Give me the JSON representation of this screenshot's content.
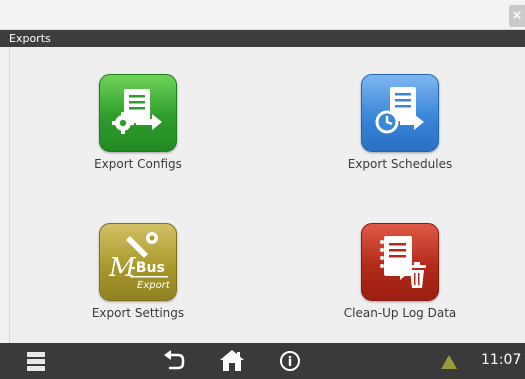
{
  "window": {
    "close_glyph": "×",
    "title": "Exports"
  },
  "tiles": [
    {
      "label": "Export Configs",
      "icon": "export-configs-icon",
      "color": "#2f9c2b"
    },
    {
      "label": "Export Schedules",
      "icon": "export-schedules-icon",
      "color": "#3a86d9"
    },
    {
      "label": "Export Settings",
      "icon": "mbus-export-icon",
      "color": "#a99a2d",
      "icon_text": {
        "top": "-Bus",
        "bottom": "Export"
      }
    },
    {
      "label": "Clean-Up Log Data",
      "icon": "cleanup-log-icon",
      "color": "#b42a1a"
    }
  ],
  "bottombar": {
    "icons": [
      "menu-icon",
      "back-icon",
      "home-icon",
      "info-icon",
      "warning-icon"
    ],
    "info_glyph": "i",
    "clock": "11:07"
  }
}
